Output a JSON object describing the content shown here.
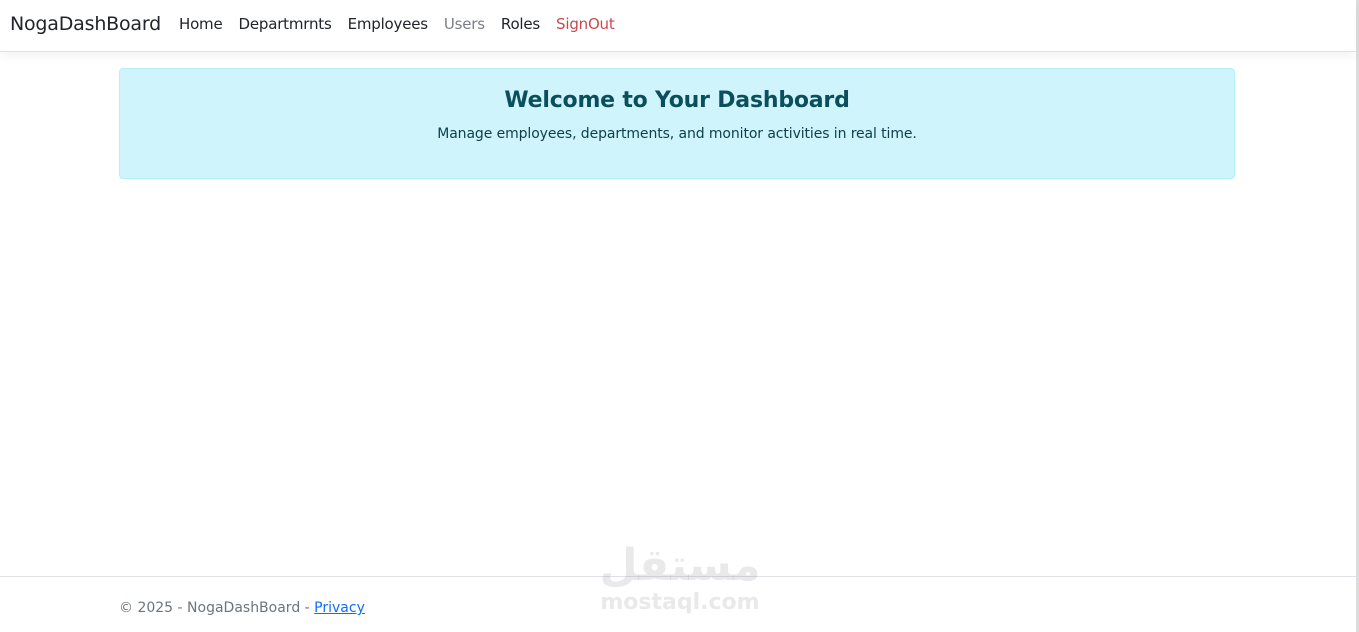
{
  "navbar": {
    "brand": "NogaDashBoard",
    "links": [
      {
        "label": "Home",
        "state": "default"
      },
      {
        "label": "Departmrnts",
        "state": "default"
      },
      {
        "label": "Employees",
        "state": "default"
      },
      {
        "label": "Users",
        "state": "muted"
      },
      {
        "label": "Roles",
        "state": "default"
      },
      {
        "label": "SignOut",
        "state": "danger"
      }
    ]
  },
  "welcome": {
    "title": "Welcome to Your Dashboard",
    "subtitle": "Manage employees, departments, and monitor activities in real time."
  },
  "footer": {
    "copyright": "© 2025 - NogaDashBoard - ",
    "privacy_label": "Privacy"
  },
  "watermark": {
    "arabic": "مستقل",
    "latin": "mostaql.com"
  },
  "colors": {
    "alert_bg": "#cff4fc",
    "alert_border": "#b6effb",
    "alert_text": "#055160",
    "link": "#0d6efd",
    "danger": "#c8494d",
    "muted": "#7a7f85"
  }
}
